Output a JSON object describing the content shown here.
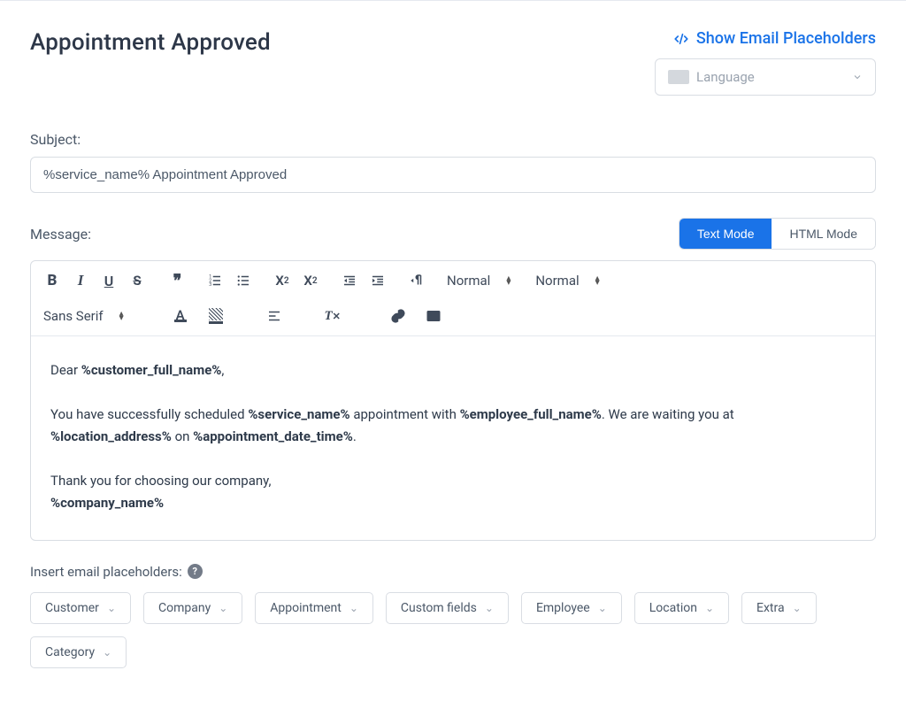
{
  "header": {
    "title": "Appointment Approved",
    "show_placeholders_label": "Show Email Placeholders",
    "language_placeholder": "Language"
  },
  "subject": {
    "label": "Subject:",
    "value": "%service_name% Appointment Approved"
  },
  "message": {
    "label": "Message:",
    "modes": {
      "text": "Text Mode",
      "html": "HTML Mode"
    },
    "toolbar": {
      "header_select": "Normal",
      "size_select": "Normal",
      "font_select": "Sans Serif"
    },
    "body": {
      "line1_pre": "Dear ",
      "ph_customer": "%customer_full_name%",
      "line1_post": ",",
      "line2_a": "You have successfully scheduled ",
      "ph_service": "%service_name%",
      "line2_b": " appointment with ",
      "ph_employee": "%employee_full_name%",
      "line2_c": ". We are waiting you at ",
      "ph_location": "%location_address%",
      "line2_d": " on ",
      "ph_datetime": "%appointment_date_time%",
      "line2_e": ".",
      "line3": "Thank you for choosing our company,",
      "ph_company": "%company_name%"
    }
  },
  "insert": {
    "label": "Insert email placeholders:",
    "pills": [
      "Customer",
      "Company",
      "Appointment",
      "Custom fields",
      "Employee",
      "Location",
      "Extra",
      "Category"
    ]
  }
}
